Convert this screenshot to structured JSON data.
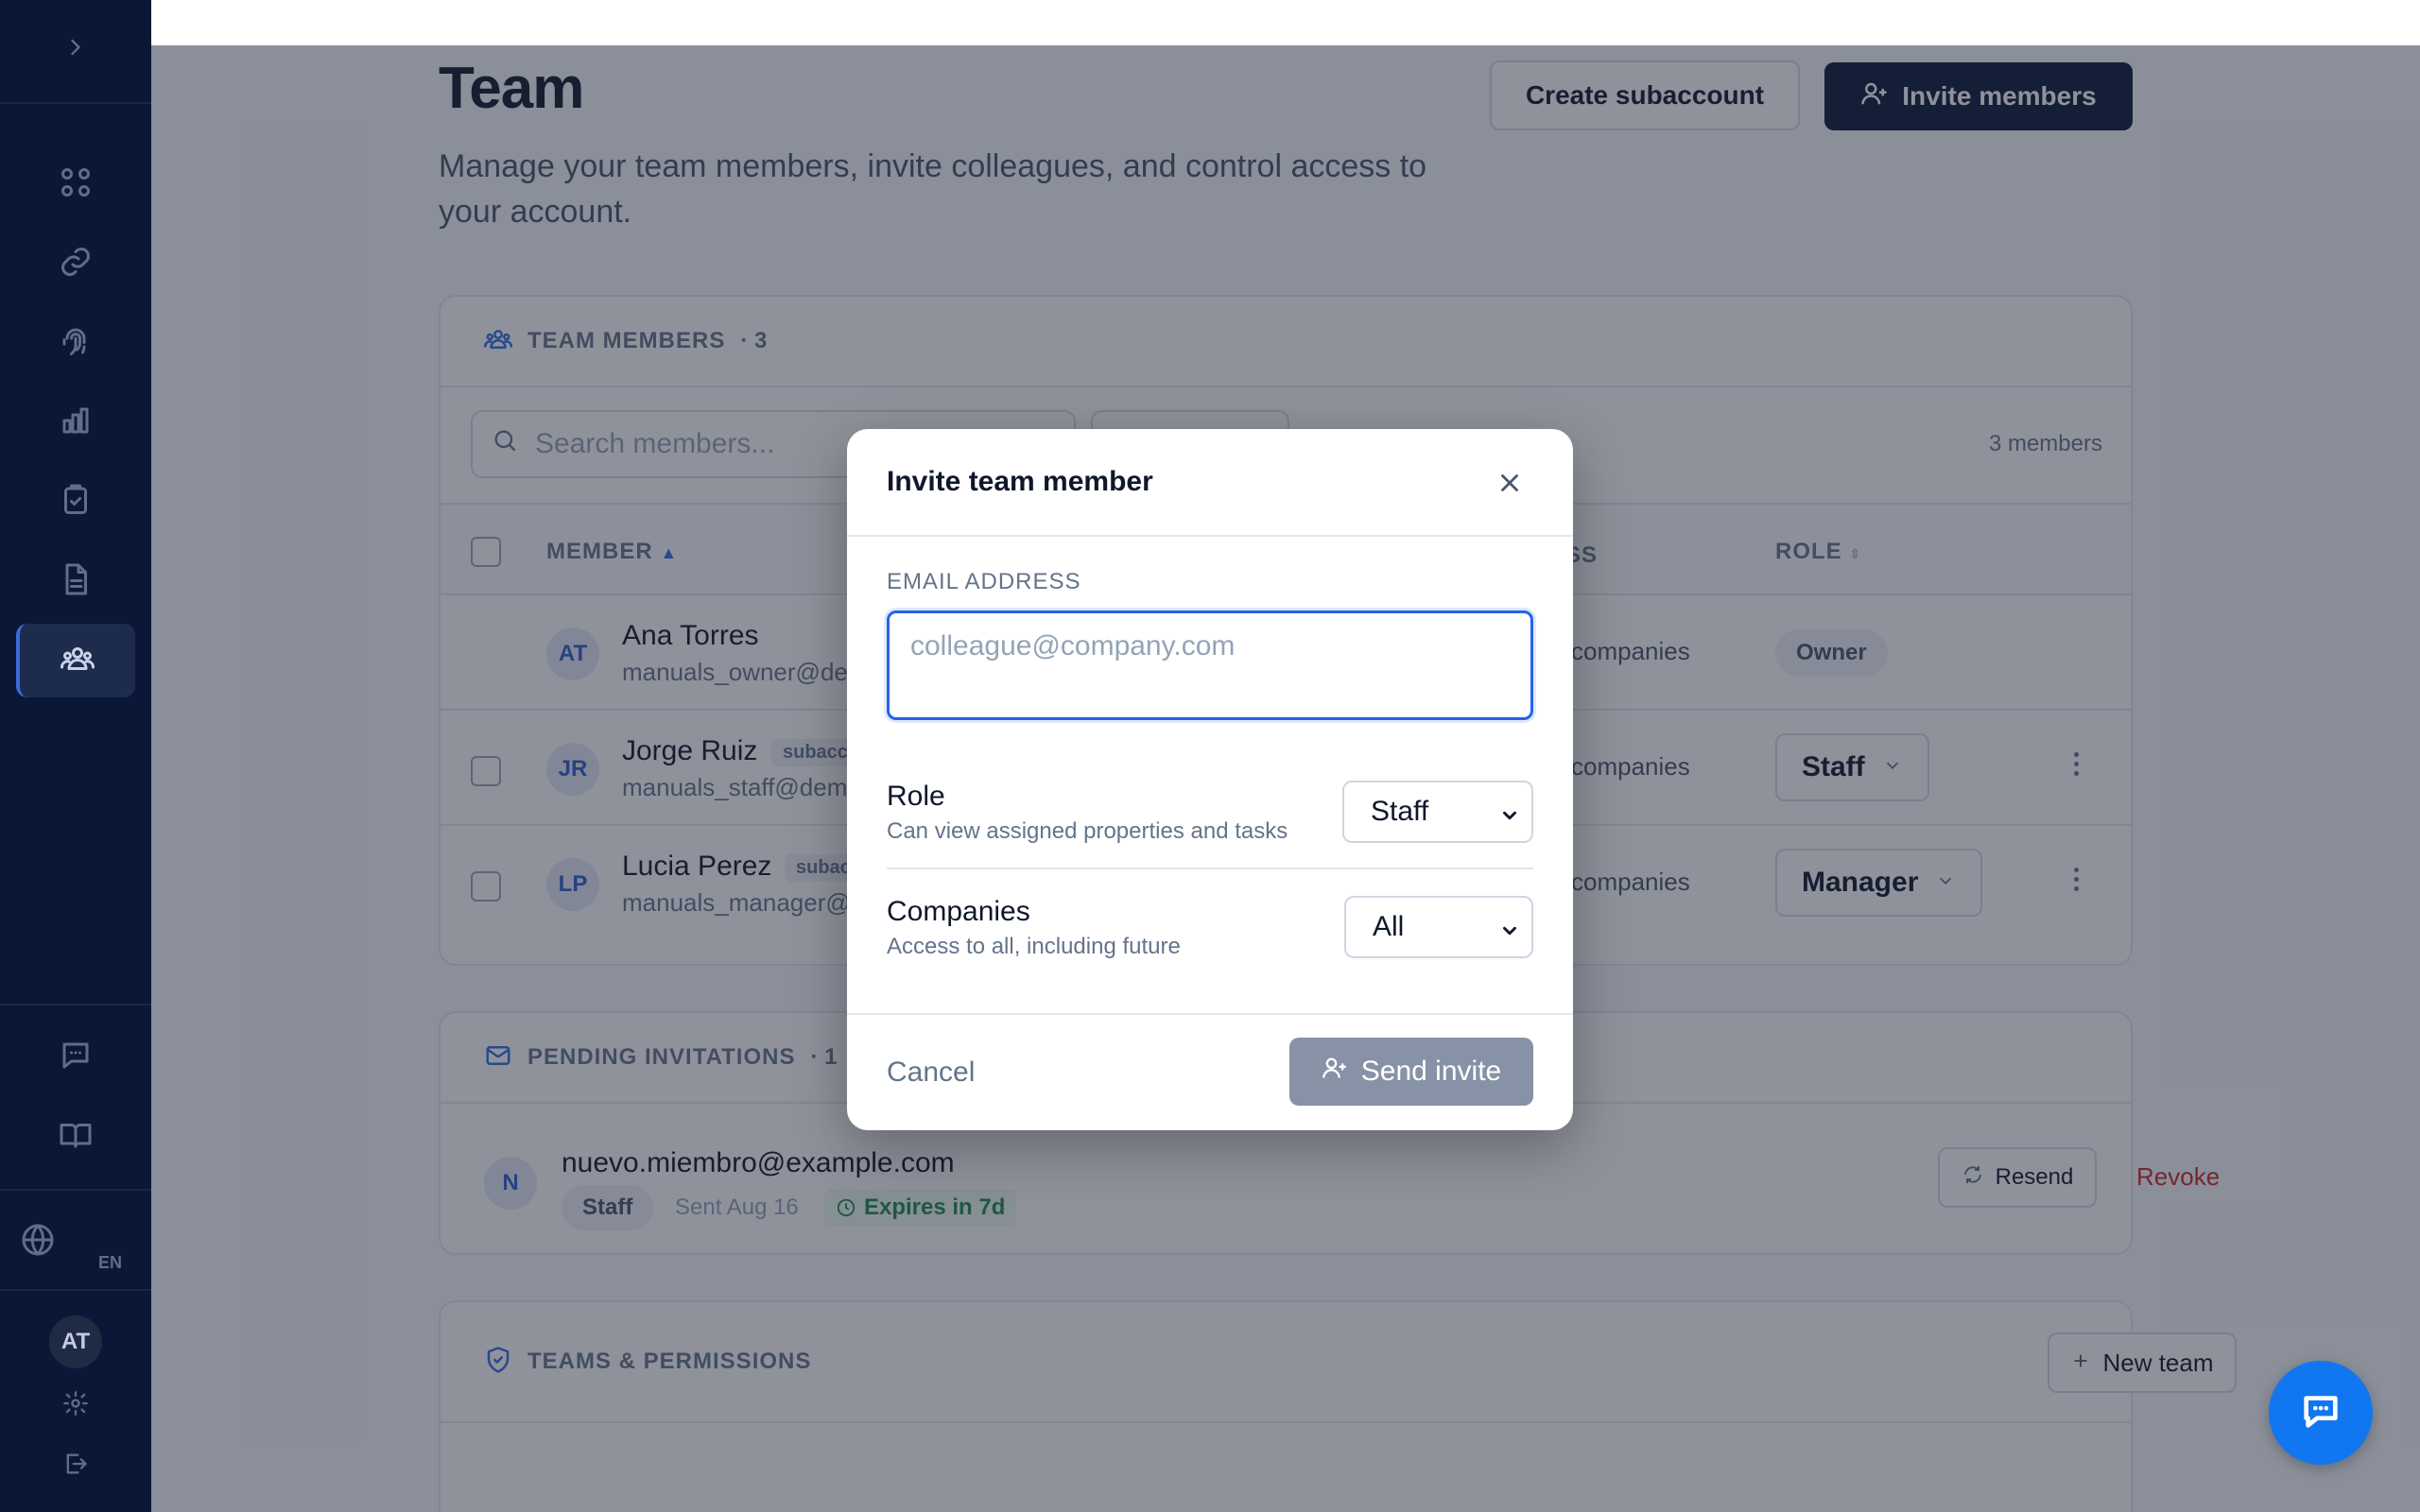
{
  "page": {
    "title": "Team",
    "description": "Manage your team members, invite colleagues, and control access to your account.",
    "create_subaccount_label": "Create subaccount",
    "invite_members_label": "Invite members"
  },
  "sidebar": {
    "language": "EN",
    "user_initials": "AT",
    "nav_icons": [
      "grid-icon",
      "link-icon",
      "fingerprint-icon",
      "bar-chart-icon",
      "clipboard-check-icon",
      "document-icon",
      "users-icon"
    ],
    "active_item": "users-icon"
  },
  "members_card": {
    "title": "TEAM MEMBERS",
    "count": "· 3",
    "search_placeholder": "Search members...",
    "total_label": "3 members",
    "columns": {
      "member": "MEMBER",
      "access": "SS",
      "role": "ROLE"
    },
    "rows": [
      {
        "initials": "AT",
        "name": "Ana Torres",
        "tag": "",
        "email": "manuals_owner@der",
        "access": "companies",
        "role": "Owner"
      },
      {
        "initials": "JR",
        "name": "Jorge Ruiz",
        "tag": "subacc",
        "email": "manuals_staff@demo",
        "access": "companies",
        "role": "Staff"
      },
      {
        "initials": "LP",
        "name": "Lucia Perez",
        "tag": "subac",
        "email": "manuals_manager@c",
        "access": "companies",
        "role": "Manager"
      }
    ]
  },
  "invitations_card": {
    "title": "PENDING INVITATIONS",
    "count": "· 1",
    "item": {
      "initial": "N",
      "email": "nuevo.miembro@example.com",
      "role": "Staff",
      "sent": "Sent Aug 16",
      "expires": "Expires in 7d",
      "resend_label": "Resend",
      "revoke_label": "Revoke"
    }
  },
  "teams_card": {
    "title": "TEAMS & PERMISSIONS",
    "new_team_label": "New team"
  },
  "modal": {
    "title": "Invite team member",
    "email_label": "EMAIL ADDRESS",
    "email_placeholder": "colleague@company.com",
    "email_value": "",
    "role": {
      "title": "Role",
      "subtitle": "Can view assigned properties and tasks",
      "value": "Staff"
    },
    "companies": {
      "title": "Companies",
      "subtitle": "Access to all, including future",
      "value": "All"
    },
    "cancel_label": "Cancel",
    "send_label": "Send invite"
  },
  "colors": {
    "sidebar": "#0b1736",
    "primary_dark": "#0b1736",
    "accent_blue": "#2563eb",
    "chat_button": "#1177f0",
    "revoke_red": "#c62828",
    "expires_green": "#1d8a4e"
  }
}
